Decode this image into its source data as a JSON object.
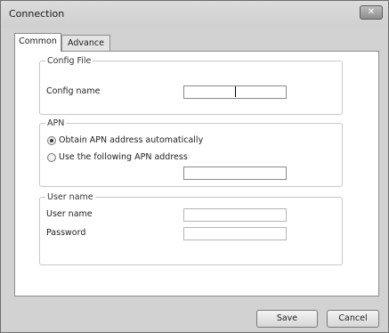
{
  "window": {
    "title": "Connection",
    "close_glyph": "✕"
  },
  "tabs": [
    {
      "label": "Common",
      "active": true
    },
    {
      "label": "Advance",
      "active": false
    }
  ],
  "config_file": {
    "legend": "Config File",
    "config_name_label": "Config name",
    "config_name_value": ""
  },
  "apn": {
    "legend": "APN",
    "options": [
      {
        "label": "Obtain APN address automatically",
        "selected": true
      },
      {
        "label": "Use the following APN address",
        "selected": false
      }
    ],
    "address_value": ""
  },
  "user": {
    "legend": "User name",
    "user_name_label": "User name",
    "user_name_value": "",
    "password_label": "Password",
    "password_value": ""
  },
  "buttons": {
    "save": "Save",
    "cancel": "Cancel"
  },
  "colors": {
    "window_bg": "#d2d2d2",
    "panel_bg": "#ffffff",
    "border": "#8c8c8c"
  },
  "icons": {
    "close": "close-icon"
  }
}
